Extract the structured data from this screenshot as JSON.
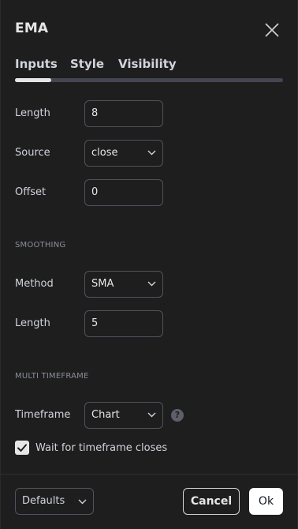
{
  "dialog": {
    "title": "EMA"
  },
  "tabs": [
    {
      "label": "Inputs",
      "active": true
    },
    {
      "label": "Style",
      "active": false
    },
    {
      "label": "Visibility",
      "active": false
    }
  ],
  "inputs": {
    "length": {
      "label": "Length",
      "value": "8"
    },
    "source": {
      "label": "Source",
      "value": "close"
    },
    "offset": {
      "label": "Offset",
      "value": "0"
    }
  },
  "smoothing": {
    "section_label": "SMOOTHING",
    "method": {
      "label": "Method",
      "value": "SMA"
    },
    "length": {
      "label": "Length",
      "value": "5"
    }
  },
  "multi_timeframe": {
    "section_label": "MULTI TIMEFRAME",
    "timeframe": {
      "label": "Timeframe",
      "value": "Chart"
    },
    "help_glyph": "?",
    "wait_closes": {
      "label": "Wait for timeframe closes",
      "checked": true
    }
  },
  "footer": {
    "defaults_label": "Defaults",
    "cancel_label": "Cancel",
    "ok_label": "Ok"
  },
  "icons": {
    "close": "close-icon",
    "chevron": "chevron-down-icon",
    "help": "question-icon",
    "check": "check-icon"
  },
  "colors": {
    "background": "#1e1e1e",
    "text": "#d1d4dc",
    "border": "#50535e",
    "ok_button": "#ffffff"
  }
}
